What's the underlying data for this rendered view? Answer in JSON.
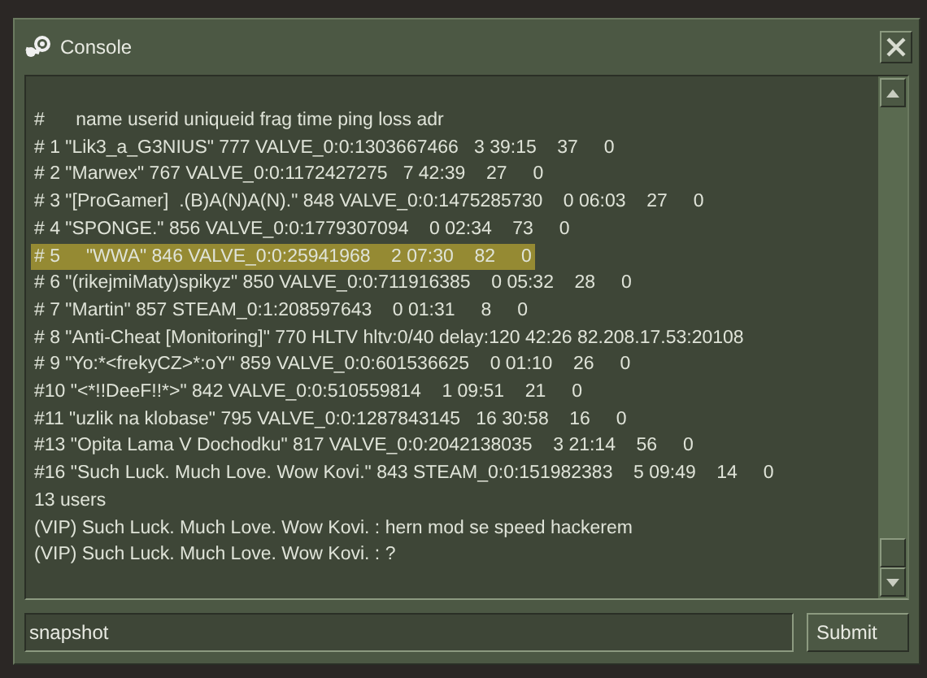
{
  "window": {
    "title": "Console"
  },
  "console_lines": [
    {
      "text": "#      name userid uniqueid frag time ping loss adr",
      "selected": false
    },
    {
      "text": "# 1 \"Lik3_a_G3NIUS\" 777 VALVE_0:0:1303667466   3 39:15    37     0",
      "selected": false
    },
    {
      "text": "# 2 \"Marwex\" 767 VALVE_0:0:1172427275   7 42:39    27     0",
      "selected": false
    },
    {
      "text": "# 3 \"[ProGamer]  .(B)A(N)A(N).\" 848 VALVE_0:0:1475285730    0 06:03    27     0",
      "selected": false
    },
    {
      "text": "# 4 \"SPONGE.\" 856 VALVE_0:0:1779307094    0 02:34    73     0",
      "selected": false
    },
    {
      "text": "# 5     \"WWA\" 846 VALVE_0:0:25941968    2 07:30    82     0",
      "selected": true
    },
    {
      "text": "# 6 \"(rikejmiMaty)spikyz\" 850 VALVE_0:0:711916385    0 05:32    28     0",
      "selected": false
    },
    {
      "text": "# 7 \"Martin\" 857 STEAM_0:1:208597643    0 01:31     8     0",
      "selected": false
    },
    {
      "text": "# 8 \"Anti-Cheat [Monitoring]\" 770 HLTV hltv:0/40 delay:120 42:26 82.208.17.53:20108",
      "selected": false
    },
    {
      "text": "# 9 \"Yo:*<frekyCZ>*:oY\" 859 VALVE_0:0:601536625    0 01:10    26     0",
      "selected": false
    },
    {
      "text": "#10 \"<*!!DeeF!!*>\" 842 VALVE_0:0:510559814    1 09:51    21     0",
      "selected": false
    },
    {
      "text": "#11 \"uzlik na klobase\" 795 VALVE_0:0:1287843145   16 30:58    16     0",
      "selected": false
    },
    {
      "text": "#13 \"Opita Lama V Dochodku\" 817 VALVE_0:0:2042138035    3 21:14    56     0",
      "selected": false
    },
    {
      "text": "#16 \"Such Luck. Much Love. Wow Kovi.\" 843 STEAM_0:0:151982383    5 09:49    14     0",
      "selected": false
    },
    {
      "text": "13 users",
      "selected": false
    },
    {
      "text": "(VIP) Such Luck. Much Love. Wow Kovi. : hern mod se speed hackerem",
      "selected": false
    },
    {
      "text": "(VIP) Such Luck. Much Love. Wow Kovi. : ?",
      "selected": false
    }
  ],
  "command": {
    "value": "snapshot"
  },
  "submit_button": "Submit"
}
